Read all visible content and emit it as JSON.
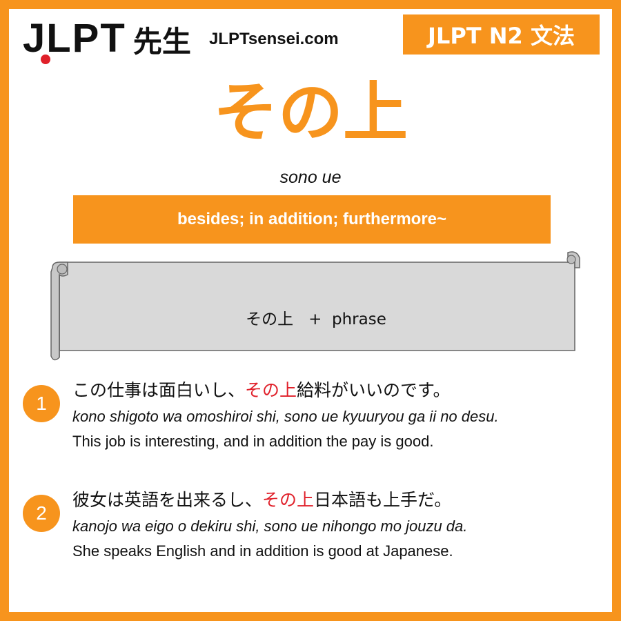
{
  "header": {
    "logo_latin": "JLPT",
    "logo_kanji": "先生",
    "site_url": "JLPTsensei.com",
    "level_badge": "JLPT N2 文法"
  },
  "grammar": {
    "title": "その上",
    "romaji": "sono ue",
    "meaning": "besides; in addition; furthermore~",
    "formula": {
      "term": "その上",
      "operator": "+",
      "component": "phrase"
    }
  },
  "examples": [
    {
      "number": "1",
      "jp_before": "この仕事は面白いし、",
      "jp_highlight": "その上",
      "jp_after": "給料がいいのです。",
      "romaji": "kono shigoto wa omoshiroi shi, sono ue kyuuryou ga ii no desu.",
      "english": "This job is interesting, and in addition the pay is good."
    },
    {
      "number": "2",
      "jp_before": "彼女は英語を出来るし、",
      "jp_highlight": "その上",
      "jp_after": "日本語も上手だ。",
      "romaji": "kanojo wa eigo o dekiru shi, sono ue nihongo mo jouzu da.",
      "english": "She speaks English and in addition is good at Japanese."
    }
  ],
  "colors": {
    "accent": "#f7941d",
    "highlight": "#e0202a",
    "scroll_fill": "#d9d9d9"
  }
}
